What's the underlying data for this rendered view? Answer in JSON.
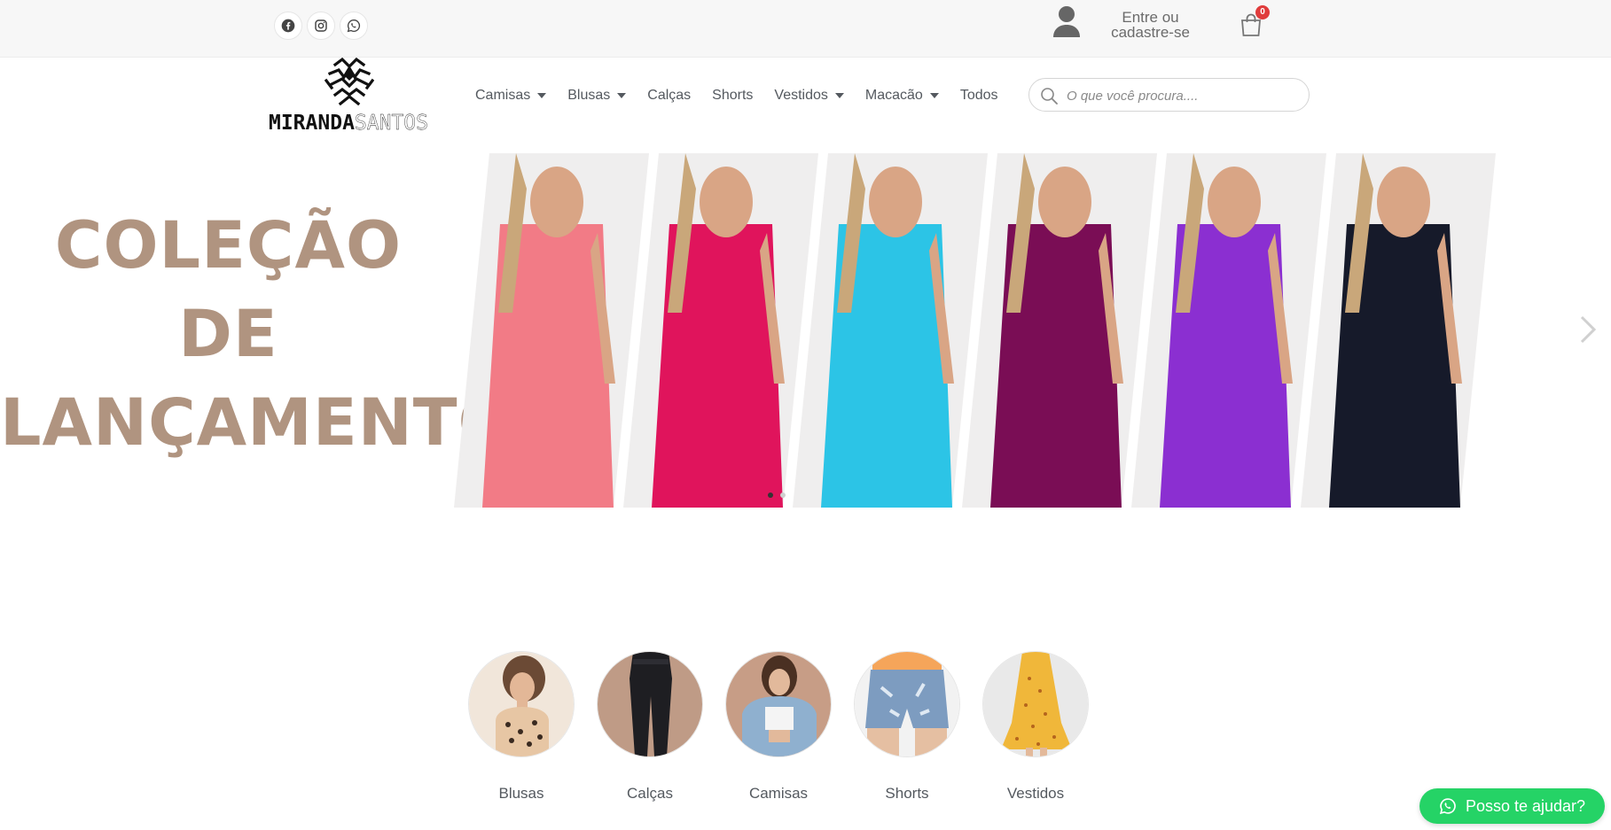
{
  "topbar": {
    "social": [
      {
        "icon": "facebook-icon"
      },
      {
        "icon": "instagram-icon"
      },
      {
        "icon": "whatsapp-icon"
      }
    ],
    "login_line1": "Entre ou",
    "login_line2": "cadastre-se",
    "cart_count": "0"
  },
  "header": {
    "logo_part1": "MIRANDA",
    "logo_part2": "SANTOS",
    "nav": [
      {
        "label": "Camisas",
        "dropdown": true
      },
      {
        "label": "Blusas",
        "dropdown": true
      },
      {
        "label": "Calças",
        "dropdown": false
      },
      {
        "label": "Shorts",
        "dropdown": false
      },
      {
        "label": "Vestidos",
        "dropdown": true
      },
      {
        "label": "Macacão",
        "dropdown": true
      },
      {
        "label": "Todos",
        "dropdown": false
      }
    ],
    "search_placeholder": "O que você procura...."
  },
  "hero": {
    "title_line1": "COLEÇÃO",
    "title_line2": "DE",
    "title_line3": "LANÇAMENTO",
    "slides": [
      {
        "color": "#f27b86",
        "name": "pink-jumpsuit"
      },
      {
        "color": "#e0145c",
        "name": "magenta-shirt"
      },
      {
        "color": "#2cc4e6",
        "name": "cyan-shirt-dress"
      },
      {
        "color": "#7a0d55",
        "name": "plum-pants"
      },
      {
        "color": "#8b2fd1",
        "name": "purple-dress"
      },
      {
        "color": "#161a2a",
        "name": "black-jumpsuit"
      }
    ],
    "active_dot": 0,
    "dot_count": 2
  },
  "categories": [
    {
      "label": "Blusas"
    },
    {
      "label": "Calças"
    },
    {
      "label": "Camisas"
    },
    {
      "label": "Shorts"
    },
    {
      "label": "Vestidos"
    }
  ],
  "whatsapp": {
    "label": "Posso te ajudar?"
  },
  "colors": {
    "accent_title": "#b09480",
    "whatsapp_green": "#25d366",
    "cart_badge": "#e03c3c"
  }
}
